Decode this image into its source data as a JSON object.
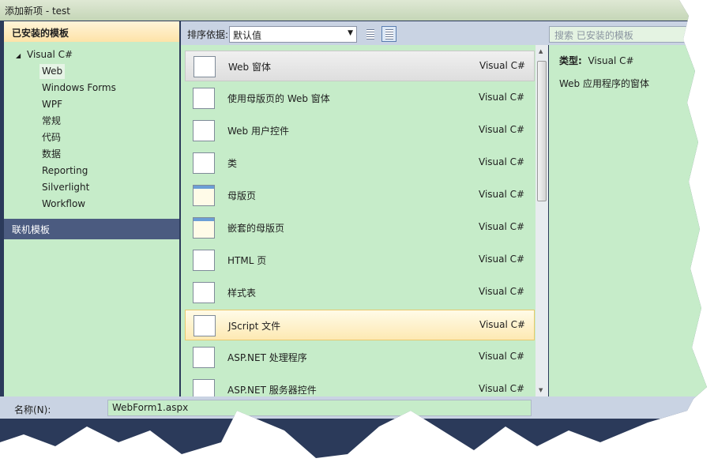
{
  "window": {
    "title": "添加新项 - test"
  },
  "sidebar": {
    "header": "已安装的模板",
    "tree_root": "Visual C#",
    "items": [
      {
        "label": "Web",
        "selected": true
      },
      {
        "label": "Windows Forms"
      },
      {
        "label": "WPF"
      },
      {
        "label": "常规"
      },
      {
        "label": "代码"
      },
      {
        "label": "数据"
      },
      {
        "label": "Reporting"
      },
      {
        "label": "Silverlight"
      },
      {
        "label": "Workflow"
      }
    ],
    "online": "联机模板"
  },
  "toolbar": {
    "sort_label": "排序依据:",
    "sort_value": "默认值",
    "search_placeholder": "搜索 已安装的模板"
  },
  "templates": [
    {
      "name": "Web 窗体",
      "lang": "Visual C#",
      "icon": "web-form-icon",
      "state": "selected"
    },
    {
      "name": "使用母版页的 Web 窗体",
      "lang": "Visual C#",
      "icon": "web-form-icon"
    },
    {
      "name": "Web 用户控件",
      "lang": "Visual C#",
      "icon": "user-control-icon"
    },
    {
      "name": "类",
      "lang": "Visual C#",
      "icon": "csharp-class-icon"
    },
    {
      "name": "母版页",
      "lang": "Visual C#",
      "icon": "master-page-icon"
    },
    {
      "name": "嵌套的母版页",
      "lang": "Visual C#",
      "icon": "master-page-icon"
    },
    {
      "name": "HTML 页",
      "lang": "Visual C#",
      "icon": "html-page-icon"
    },
    {
      "name": "样式表",
      "lang": "Visual C#",
      "icon": "stylesheet-icon"
    },
    {
      "name": "JScript 文件",
      "lang": "Visual C#",
      "icon": "jscript-icon",
      "state": "hover"
    },
    {
      "name": "ASP.NET 处理程序",
      "lang": "Visual C#",
      "icon": "handler-icon"
    },
    {
      "name": "ASP.NET 服务器控件",
      "lang": "Visual C#",
      "icon": "server-control-icon"
    }
  ],
  "details": {
    "type_label": "类型:",
    "type_value": "Visual C#",
    "description": "Web 应用程序的窗体"
  },
  "name_field": {
    "label": "名称(N):",
    "value": "WebForm1.aspx"
  }
}
